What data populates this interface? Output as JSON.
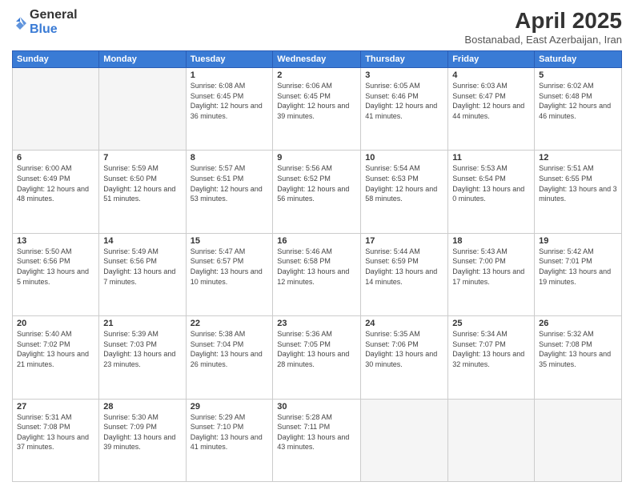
{
  "logo": {
    "general": "General",
    "blue": "Blue"
  },
  "title": "April 2025",
  "location": "Bostanabad, East Azerbaijan, Iran",
  "days_of_week": [
    "Sunday",
    "Monday",
    "Tuesday",
    "Wednesday",
    "Thursday",
    "Friday",
    "Saturday"
  ],
  "weeks": [
    [
      {
        "day": "",
        "empty": true
      },
      {
        "day": "",
        "empty": true
      },
      {
        "day": "1",
        "sunrise": "Sunrise: 6:08 AM",
        "sunset": "Sunset: 6:45 PM",
        "daylight": "Daylight: 12 hours and 36 minutes."
      },
      {
        "day": "2",
        "sunrise": "Sunrise: 6:06 AM",
        "sunset": "Sunset: 6:45 PM",
        "daylight": "Daylight: 12 hours and 39 minutes."
      },
      {
        "day": "3",
        "sunrise": "Sunrise: 6:05 AM",
        "sunset": "Sunset: 6:46 PM",
        "daylight": "Daylight: 12 hours and 41 minutes."
      },
      {
        "day": "4",
        "sunrise": "Sunrise: 6:03 AM",
        "sunset": "Sunset: 6:47 PM",
        "daylight": "Daylight: 12 hours and 44 minutes."
      },
      {
        "day": "5",
        "sunrise": "Sunrise: 6:02 AM",
        "sunset": "Sunset: 6:48 PM",
        "daylight": "Daylight: 12 hours and 46 minutes."
      }
    ],
    [
      {
        "day": "6",
        "sunrise": "Sunrise: 6:00 AM",
        "sunset": "Sunset: 6:49 PM",
        "daylight": "Daylight: 12 hours and 48 minutes."
      },
      {
        "day": "7",
        "sunrise": "Sunrise: 5:59 AM",
        "sunset": "Sunset: 6:50 PM",
        "daylight": "Daylight: 12 hours and 51 minutes."
      },
      {
        "day": "8",
        "sunrise": "Sunrise: 5:57 AM",
        "sunset": "Sunset: 6:51 PM",
        "daylight": "Daylight: 12 hours and 53 minutes."
      },
      {
        "day": "9",
        "sunrise": "Sunrise: 5:56 AM",
        "sunset": "Sunset: 6:52 PM",
        "daylight": "Daylight: 12 hours and 56 minutes."
      },
      {
        "day": "10",
        "sunrise": "Sunrise: 5:54 AM",
        "sunset": "Sunset: 6:53 PM",
        "daylight": "Daylight: 12 hours and 58 minutes."
      },
      {
        "day": "11",
        "sunrise": "Sunrise: 5:53 AM",
        "sunset": "Sunset: 6:54 PM",
        "daylight": "Daylight: 13 hours and 0 minutes."
      },
      {
        "day": "12",
        "sunrise": "Sunrise: 5:51 AM",
        "sunset": "Sunset: 6:55 PM",
        "daylight": "Daylight: 13 hours and 3 minutes."
      }
    ],
    [
      {
        "day": "13",
        "sunrise": "Sunrise: 5:50 AM",
        "sunset": "Sunset: 6:56 PM",
        "daylight": "Daylight: 13 hours and 5 minutes."
      },
      {
        "day": "14",
        "sunrise": "Sunrise: 5:49 AM",
        "sunset": "Sunset: 6:56 PM",
        "daylight": "Daylight: 13 hours and 7 minutes."
      },
      {
        "day": "15",
        "sunrise": "Sunrise: 5:47 AM",
        "sunset": "Sunset: 6:57 PM",
        "daylight": "Daylight: 13 hours and 10 minutes."
      },
      {
        "day": "16",
        "sunrise": "Sunrise: 5:46 AM",
        "sunset": "Sunset: 6:58 PM",
        "daylight": "Daylight: 13 hours and 12 minutes."
      },
      {
        "day": "17",
        "sunrise": "Sunrise: 5:44 AM",
        "sunset": "Sunset: 6:59 PM",
        "daylight": "Daylight: 13 hours and 14 minutes."
      },
      {
        "day": "18",
        "sunrise": "Sunrise: 5:43 AM",
        "sunset": "Sunset: 7:00 PM",
        "daylight": "Daylight: 13 hours and 17 minutes."
      },
      {
        "day": "19",
        "sunrise": "Sunrise: 5:42 AM",
        "sunset": "Sunset: 7:01 PM",
        "daylight": "Daylight: 13 hours and 19 minutes."
      }
    ],
    [
      {
        "day": "20",
        "sunrise": "Sunrise: 5:40 AM",
        "sunset": "Sunset: 7:02 PM",
        "daylight": "Daylight: 13 hours and 21 minutes."
      },
      {
        "day": "21",
        "sunrise": "Sunrise: 5:39 AM",
        "sunset": "Sunset: 7:03 PM",
        "daylight": "Daylight: 13 hours and 23 minutes."
      },
      {
        "day": "22",
        "sunrise": "Sunrise: 5:38 AM",
        "sunset": "Sunset: 7:04 PM",
        "daylight": "Daylight: 13 hours and 26 minutes."
      },
      {
        "day": "23",
        "sunrise": "Sunrise: 5:36 AM",
        "sunset": "Sunset: 7:05 PM",
        "daylight": "Daylight: 13 hours and 28 minutes."
      },
      {
        "day": "24",
        "sunrise": "Sunrise: 5:35 AM",
        "sunset": "Sunset: 7:06 PM",
        "daylight": "Daylight: 13 hours and 30 minutes."
      },
      {
        "day": "25",
        "sunrise": "Sunrise: 5:34 AM",
        "sunset": "Sunset: 7:07 PM",
        "daylight": "Daylight: 13 hours and 32 minutes."
      },
      {
        "day": "26",
        "sunrise": "Sunrise: 5:32 AM",
        "sunset": "Sunset: 7:08 PM",
        "daylight": "Daylight: 13 hours and 35 minutes."
      }
    ],
    [
      {
        "day": "27",
        "sunrise": "Sunrise: 5:31 AM",
        "sunset": "Sunset: 7:08 PM",
        "daylight": "Daylight: 13 hours and 37 minutes."
      },
      {
        "day": "28",
        "sunrise": "Sunrise: 5:30 AM",
        "sunset": "Sunset: 7:09 PM",
        "daylight": "Daylight: 13 hours and 39 minutes."
      },
      {
        "day": "29",
        "sunrise": "Sunrise: 5:29 AM",
        "sunset": "Sunset: 7:10 PM",
        "daylight": "Daylight: 13 hours and 41 minutes."
      },
      {
        "day": "30",
        "sunrise": "Sunrise: 5:28 AM",
        "sunset": "Sunset: 7:11 PM",
        "daylight": "Daylight: 13 hours and 43 minutes."
      },
      {
        "day": "",
        "empty": true
      },
      {
        "day": "",
        "empty": true
      },
      {
        "day": "",
        "empty": true
      }
    ]
  ]
}
